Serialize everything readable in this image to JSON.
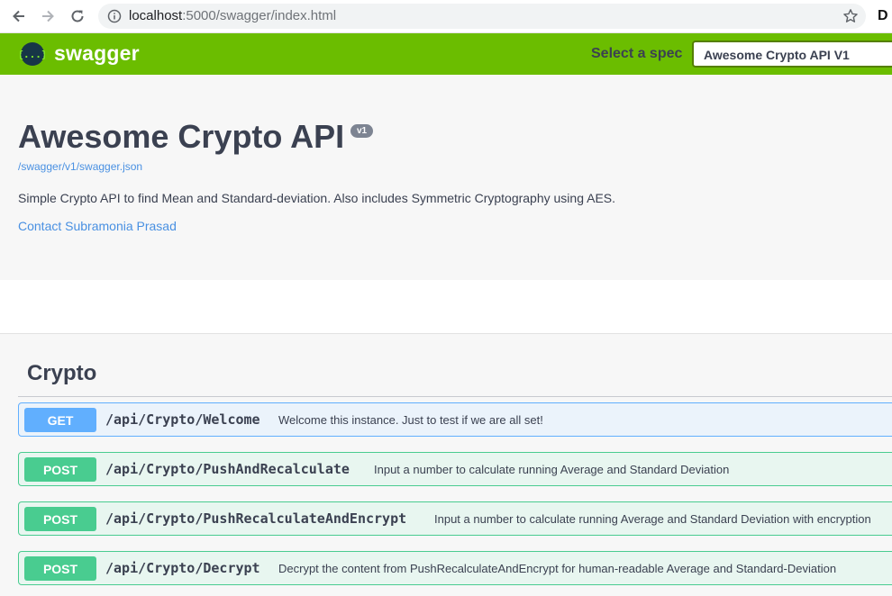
{
  "browser": {
    "url_host": "localhost",
    "url_rest": ":5000/swagger/index.html",
    "ext_label": "D"
  },
  "topbar": {
    "brand": "swagger",
    "spec_label": "Select a spec",
    "spec_selected": "Awesome Crypto API V1",
    "color": "#6bbd00"
  },
  "info": {
    "title": "Awesome Crypto API",
    "version": "v1",
    "spec_link": "/swagger/v1/swagger.json",
    "description": "Simple Crypto API to find Mean and Standard-deviation. Also includes Symmetric Cryptography using AES.",
    "contact": "Contact Subramonia Prasad"
  },
  "tag": {
    "name": "Crypto"
  },
  "operations": [
    {
      "method": "GET",
      "path": "/api/Crypto/Welcome",
      "summary": "Welcome this instance. Just to test if we are all set!"
    },
    {
      "method": "POST",
      "path": "/api/Crypto/PushAndRecalculate",
      "summary": "Input a number to calculate running Average and Standard Deviation"
    },
    {
      "method": "POST",
      "path": "/api/Crypto/PushRecalculateAndEncrypt",
      "summary": "Input a number to calculate running Average and Standard Deviation with encryption"
    },
    {
      "method": "POST",
      "path": "/api/Crypto/Decrypt",
      "summary": "Decrypt the content from PushRecalculateAndEncrypt for human-readable Average and Standard-Deviation"
    }
  ],
  "icons": {
    "back": "arrow-left-icon",
    "forward": "arrow-right-icon",
    "reload": "reload-icon",
    "info": "info-icon",
    "bookmark": "star-icon",
    "logo": "swagger-logo-icon"
  },
  "colors": {
    "get": "#61affe",
    "post": "#49cc90",
    "link": "#4990e2"
  }
}
